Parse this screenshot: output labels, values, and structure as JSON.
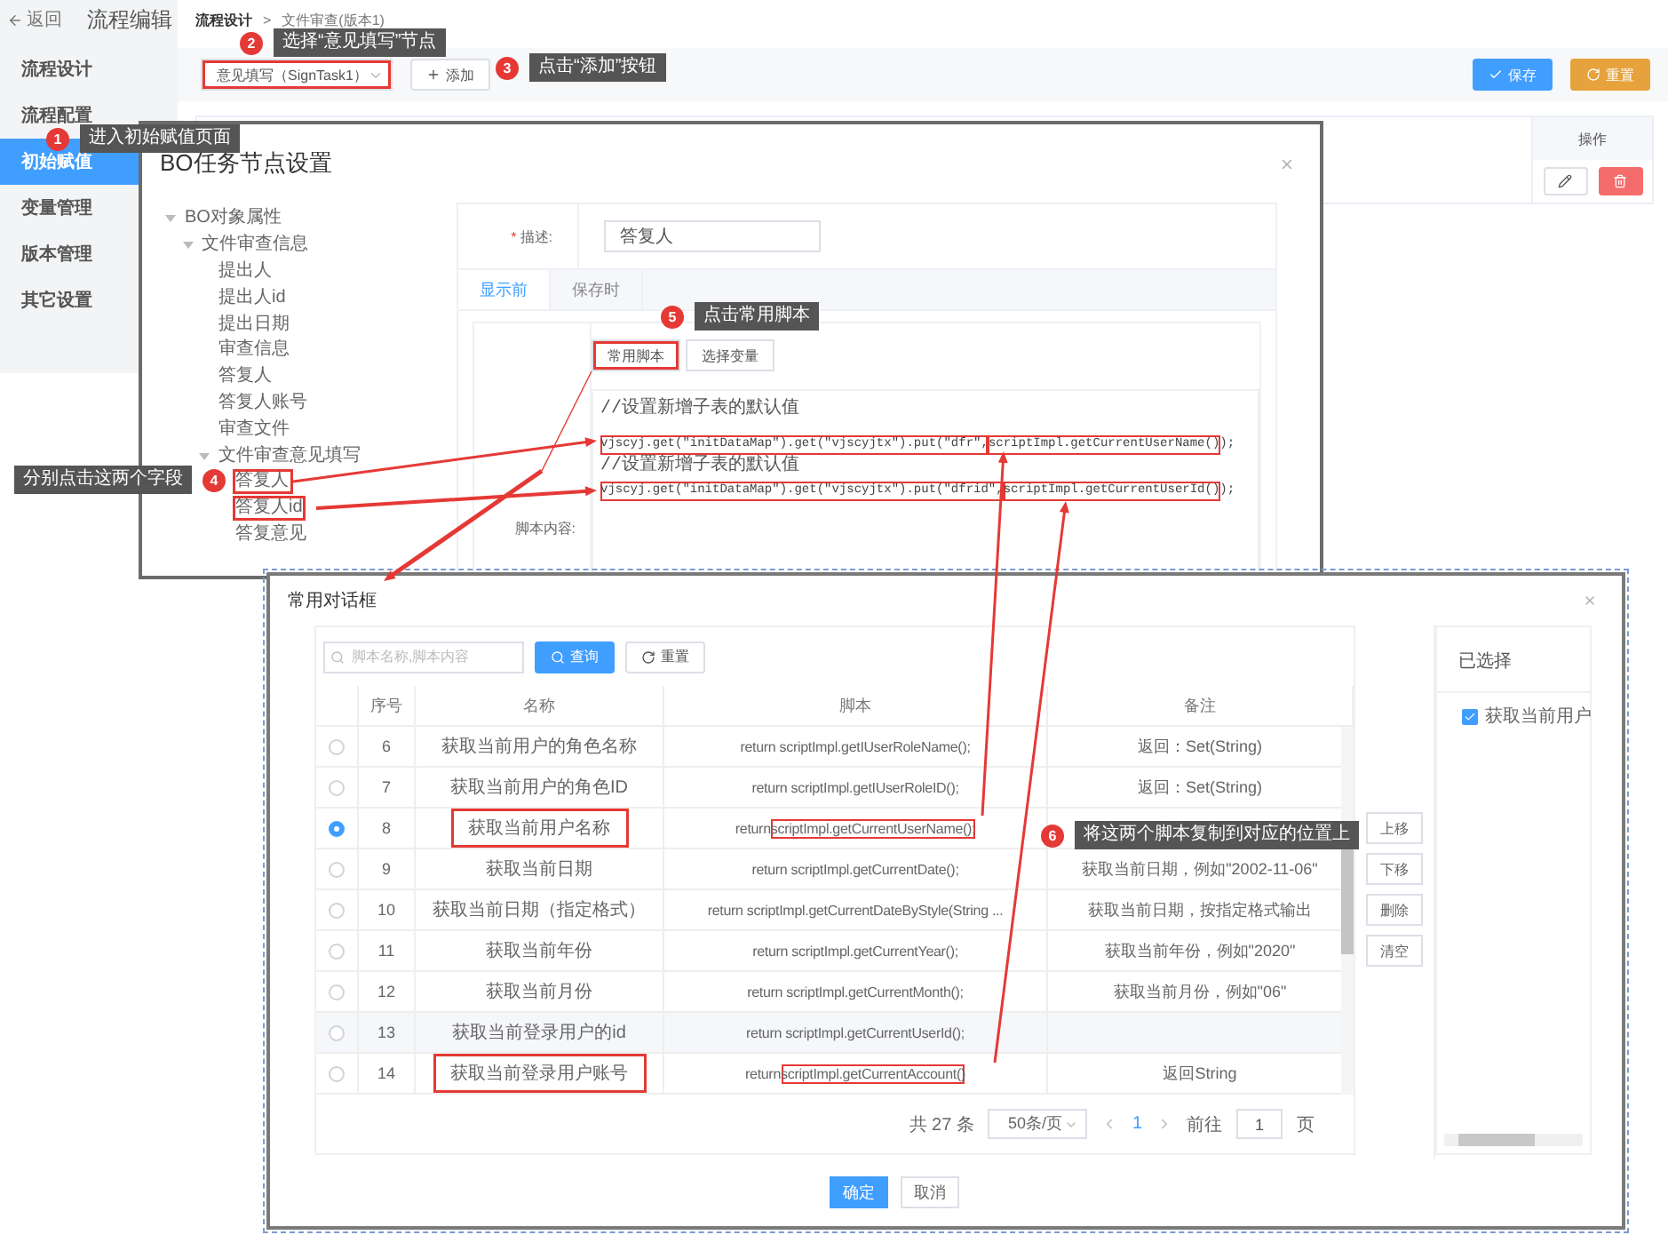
{
  "header": {
    "back": "返回",
    "title": "流程编辑"
  },
  "breadcrumb": {
    "items": [
      "流程设计",
      "文件审查(版本1)"
    ],
    "separator": ">"
  },
  "sidebar": {
    "items": [
      {
        "label": "流程设计",
        "selected": false
      },
      {
        "label": "流程配置",
        "selected": false
      },
      {
        "label": "初始赋值",
        "selected": true
      },
      {
        "label": "变量管理",
        "selected": false
      },
      {
        "label": "版本管理",
        "selected": false
      },
      {
        "label": "其它设置",
        "selected": false
      }
    ]
  },
  "toolbar": {
    "node_select": {
      "value": "意见填写（SignTask1）",
      "marked": true
    },
    "add": "添加",
    "save": "保存",
    "reset": "重置"
  },
  "table": {
    "columns": [
      "操作"
    ]
  },
  "node_dialog": {
    "title": "BO任务节点设置",
    "tree": [
      {
        "label": "BO对象属性",
        "expanded": true,
        "marked": false,
        "children": [
          {
            "label": "文件审查信息",
            "expanded": true,
            "marked": false,
            "children": [
              {
                "label": "提出人",
                "marked": false
              },
              {
                "label": "提出人id",
                "marked": false
              },
              {
                "label": "提出日期",
                "marked": false
              },
              {
                "label": "审查信息",
                "marked": false
              },
              {
                "label": "答复人",
                "marked": false
              },
              {
                "label": "答复人账号",
                "marked": false
              },
              {
                "label": "审查文件",
                "marked": false
              },
              {
                "label": "文件审查意见填写",
                "expanded": true,
                "marked": false,
                "children": [
                  {
                    "label": "答复人",
                    "marked": true
                  },
                  {
                    "label": "答复人id",
                    "marked": true
                  },
                  {
                    "label": "答复意见",
                    "marked": false
                  }
                ]
              }
            ]
          }
        ]
      }
    ],
    "description": {
      "label": "描述:",
      "required_mark": "*",
      "value": "答复人"
    },
    "tabs": [
      {
        "label": "显示前",
        "selected": true
      },
      {
        "label": "保存时",
        "selected": false
      }
    ],
    "script_buttons": [
      {
        "label": "常用脚本",
        "marked": true
      },
      {
        "label": "选择变量",
        "marked": false
      }
    ],
    "script_label": "脚本内容:",
    "code_lines": [
      {
        "kind": "comment",
        "text": "//设置新增子表的默认值"
      },
      {
        "kind": "code",
        "segments": [
          {
            "text": "vjscyj.get(\"initDataMap\").get(\"vjscyjtx\").put(\"dfr\",",
            "boxed": true
          },
          {
            "text": "scriptImpl.getCurrentUserName()",
            "boxed": true
          },
          {
            "text": ");",
            "boxed": false
          }
        ]
      },
      {
        "kind": "comment",
        "text": "//设置新增子表的默认值"
      },
      {
        "kind": "code",
        "segments": [
          {
            "text": "vjscyj.get(\"initDataMap\").get(\"vjscyjtx\").put(\"dfrid\",",
            "boxed": true
          },
          {
            "text": "scriptImpl.getCurrentUserId()",
            "boxed": true
          },
          {
            "text": ");",
            "boxed": false
          }
        ]
      }
    ]
  },
  "script_dialog": {
    "title": "常用对话框",
    "search": {
      "placeholder": "脚本名称,脚本内容",
      "query": "查询",
      "reset": "重置"
    },
    "columns": [
      "序号",
      "名称",
      "脚本",
      "备注"
    ],
    "rows": [
      {
        "selected": false,
        "index": "6",
        "name": "获取当前用户的角色名称",
        "name_marked": false,
        "script": [
          {
            "text": "return scriptImpl.getIUserRoleName();",
            "boxed": false
          }
        ],
        "note": "返回：Set(String)"
      },
      {
        "selected": false,
        "index": "7",
        "name": "获取当前用户的角色ID",
        "name_marked": false,
        "script": [
          {
            "text": "return scriptImpl.getIUserRoleID();",
            "boxed": false
          }
        ],
        "note": "返回：Set(String)"
      },
      {
        "selected": true,
        "index": "8",
        "name": "获取当前用户名称",
        "name_marked": true,
        "script": [
          {
            "text": "return ",
            "boxed": false
          },
          {
            "text": "scriptImpl.getCurrentUserName();",
            "boxed": true
          }
        ]
      },
      {
        "selected": false,
        "index": "9",
        "name": "获取当前日期",
        "name_marked": false,
        "script": [
          {
            "text": "return scriptImpl.getCurrentDate();",
            "boxed": false
          }
        ],
        "note": "获取当前日期，例如\"2002-11-06\""
      },
      {
        "selected": false,
        "index": "10",
        "name": "获取当前日期（指定格式）",
        "name_marked": false,
        "script": [
          {
            "text": "return scriptImpl.getCurrentDateByStyle(String ...",
            "boxed": false
          }
        ],
        "note": "获取当前日期，按指定格式输出"
      },
      {
        "selected": false,
        "index": "11",
        "name": "获取当前年份",
        "name_marked": false,
        "script": [
          {
            "text": "return scriptImpl.getCurrentYear();",
            "boxed": false
          }
        ],
        "note": "获取当前年份，例如\"2020\""
      },
      {
        "selected": false,
        "index": "12",
        "name": "获取当前月份",
        "name_marked": false,
        "script": [
          {
            "text": "return scriptImpl.getCurrentMonth();",
            "boxed": false
          }
        ],
        "note": "获取当前月份，例如\"06\""
      },
      {
        "selected": false,
        "index": "13",
        "name": "获取当前登录用户的id",
        "name_marked": false,
        "script": [
          {
            "text": "return scriptImpl.getCurrentUserId();",
            "boxed": false
          }
        ]
      },
      {
        "selected": false,
        "index": "14",
        "name": "获取当前登录用户账号",
        "name_marked": true,
        "script": [
          {
            "text": "return ",
            "boxed": false
          },
          {
            "text": "scriptImpl.getCurrentAccount()",
            "boxed": true
          }
        ],
        "note": "返回String"
      }
    ],
    "pagination": {
      "total": "共 27 条",
      "page_size": "50条/页",
      "current": "1",
      "goto": "前往",
      "goto_value": "1",
      "unit": "页"
    },
    "side_buttons": [
      "上移",
      "下移",
      "删除",
      "清空"
    ],
    "selected_panel": {
      "title": "已选择",
      "items": [
        {
          "label": "获取当前用户",
          "checked": true
        }
      ]
    },
    "footer": [
      {
        "label": "确定",
        "kind": "primary"
      },
      {
        "label": "取消",
        "kind": "default"
      }
    ]
  },
  "callouts": [
    {
      "number": "1",
      "text": "进入初始赋值页面"
    },
    {
      "number": "2",
      "text": "选择“意见填写”节点"
    },
    {
      "number": "3",
      "text": "点击“添加”按钮"
    },
    {
      "number": "4",
      "text": "分别点击这两个字段"
    },
    {
      "number": "5",
      "text": "点击常用脚本"
    },
    {
      "number": "6",
      "text": "将这两个脚本复制到对应的位置上"
    }
  ]
}
